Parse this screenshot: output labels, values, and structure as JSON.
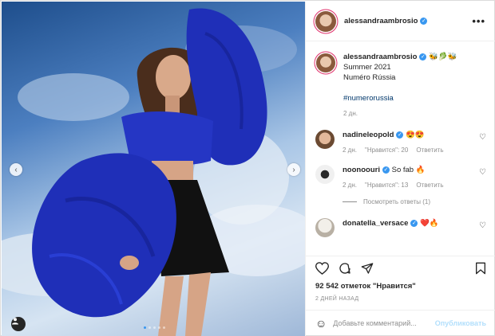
{
  "post": {
    "author": "alessandraambrosio",
    "caption_emoji": "🐝🥬🐝",
    "caption_lines": [
      "Summer 2021",
      "Numéro Rússia"
    ],
    "hashtag": "#numerorussia",
    "caption_time": "2 дн.",
    "carousel": {
      "slides": 5,
      "active": 1
    }
  },
  "comments": [
    {
      "user": "nadineleopold",
      "verified": true,
      "text": "😍😍",
      "time": "2 дн.",
      "likes": "\"Нравится\": 20",
      "reply": "Ответить"
    },
    {
      "user": "noonoouri",
      "verified": true,
      "text": "So fab 🔥",
      "time": "2 дн.",
      "likes": "\"Нравится\": 13",
      "reply": "Ответить"
    },
    {
      "user": "donatella_versace",
      "verified": true,
      "text": "❤️🔥"
    }
  ],
  "view_replies": "Посмотреть ответы (1)",
  "likes_text": "92 542 отметок \"Нравится\"",
  "post_date": "2 ДНЕЙ НАЗАД",
  "add_comment": {
    "placeholder": "Добавьте комментарий...",
    "publish": "Опубликовать"
  },
  "icons": {
    "header_more": "more-options-icon",
    "like": "heart-icon",
    "comment": "comment-icon",
    "share": "paper-plane-icon",
    "save": "bookmark-icon",
    "emoji": "smiley-icon",
    "prev": "chevron-left-icon",
    "next": "chevron-right-icon",
    "tag": "user-tag-icon"
  },
  "colors": {
    "verified": "#3897f0",
    "link": "#00376b",
    "muted": "#8e8e8e",
    "publish_disabled": "#b2dffc",
    "dress_blue": "#1f2fb8"
  },
  "glyphs": {
    "verified": "✓",
    "more": "•••",
    "prev": "‹",
    "next": "›",
    "heart": "♡",
    "emoji": "☺"
  }
}
